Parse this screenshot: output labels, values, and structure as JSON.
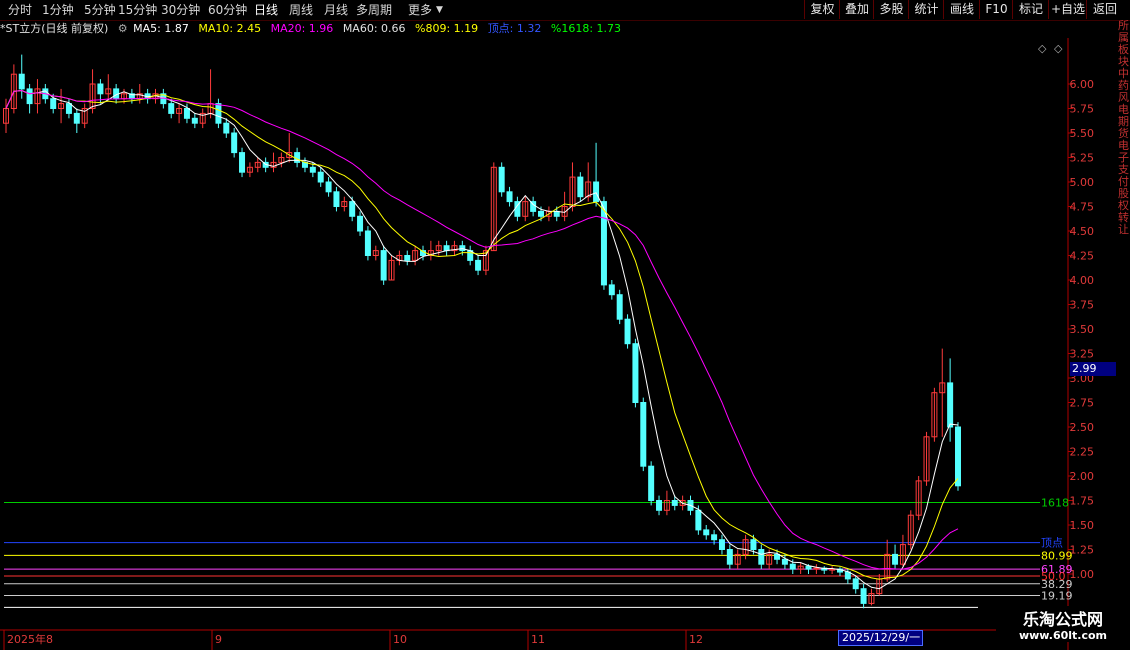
{
  "toolbar": {
    "periods": [
      "分时",
      "1分钟",
      "5分钟",
      "15分钟",
      "30分钟",
      "60分钟",
      "日线",
      "周线",
      "月线",
      "多周期",
      "更多"
    ],
    "active": "日线",
    "right_buttons": [
      "复权",
      "叠加",
      "多股",
      "统计",
      "画线",
      "F10",
      "标记",
      "+自选",
      "返回"
    ]
  },
  "info": {
    "title": "*ST立方(日线 前复权)",
    "ma5": "MA5: 1.87",
    "ma10": "MA10: 2.45",
    "ma20": "MA20: 1.96",
    "ma60": "MA60: 0.66",
    "p809": "%809: 1.19",
    "dingdian": "顶点: 1.32",
    "p1618": "%1618: 1.73",
    "colors": {
      "ma5": "#ffffff",
      "ma10": "#ffff00",
      "ma20": "#ff00ff",
      "ma60": "#00ff00",
      "p809": "#ffff00",
      "dingdian": "#3355ff",
      "p1618": "#00ff00"
    }
  },
  "y_axis": [
    "6.00",
    "5.75",
    "5.50",
    "5.25",
    "5.00",
    "4.75",
    "4.50",
    "4.25",
    "4.00",
    "3.75",
    "3.50",
    "3.25",
    "3.00",
    "2.75",
    "2.50",
    "2.25",
    "2.00",
    "1.75",
    "1.50",
    "1.25",
    "1.00"
  ],
  "fib_lines": [
    {
      "label": "1618",
      "value": 1.73,
      "color": "#00cc00"
    },
    {
      "label": "顶点",
      "value": 1.32,
      "color": "#2244ff"
    },
    {
      "label": "80.99",
      "value": 1.19,
      "color": "#ffff00"
    },
    {
      "label": "61.89",
      "value": 1.05,
      "color": "#ff44ff"
    },
    {
      "label": "50.0",
      "value": 0.98,
      "color": "#ff3333"
    },
    {
      "label": "38.29",
      "value": 0.9,
      "color": "#cccccc"
    },
    {
      "label": "19.19",
      "value": 0.78,
      "color": "#cccccc"
    },
    {
      "label": "",
      "value": 0.66,
      "color": "#ffffff"
    }
  ],
  "x_axis": [
    "2025年8",
    "9",
    "10",
    "11",
    "12"
  ],
  "current_price": "2.99",
  "date_label": "2025/12/29/一",
  "watermark": {
    "name": "乐淘公式网",
    "url": "www.60lt.com"
  },
  "right_strip": "所属板块中药风电期货电子支付股权转让",
  "chart_data": {
    "type": "candlestick",
    "y_range": [
      0.55,
      6.6
    ],
    "ma_colors": {
      "ma5": "#ffffff",
      "ma10": "#ffff00",
      "ma20": "#ff00ff"
    },
    "candles": [
      [
        5.6,
        5.75,
        5.5,
        5.85
      ],
      [
        5.75,
        6.1,
        5.7,
        6.2
      ],
      [
        6.1,
        5.95,
        5.85,
        6.3
      ],
      [
        5.95,
        5.8,
        5.7,
        6.0
      ],
      [
        5.8,
        5.95,
        5.7,
        6.05
      ],
      [
        5.95,
        5.85,
        5.8,
        6.0
      ],
      [
        5.85,
        5.75,
        5.7,
        5.9
      ],
      [
        5.75,
        5.8,
        5.6,
        5.95
      ],
      [
        5.8,
        5.7,
        5.65,
        5.85
      ],
      [
        5.7,
        5.6,
        5.5,
        5.75
      ],
      [
        5.6,
        5.75,
        5.55,
        5.8
      ],
      [
        5.75,
        6.0,
        5.7,
        6.15
      ],
      [
        6.0,
        5.9,
        5.8,
        6.05
      ],
      [
        5.9,
        5.95,
        5.85,
        6.1
      ],
      [
        5.95,
        5.85,
        5.8,
        6.0
      ],
      [
        5.85,
        5.9,
        5.8,
        5.95
      ],
      [
        5.9,
        5.85,
        5.8,
        5.95
      ],
      [
        5.85,
        5.9,
        5.8,
        6.0
      ],
      [
        5.9,
        5.85,
        5.8,
        5.95
      ],
      [
        5.85,
        5.9,
        5.8,
        5.95
      ],
      [
        5.9,
        5.8,
        5.75,
        5.95
      ],
      [
        5.8,
        5.7,
        5.65,
        5.85
      ],
      [
        5.7,
        5.75,
        5.6,
        5.8
      ],
      [
        5.75,
        5.65,
        5.6,
        5.8
      ],
      [
        5.65,
        5.6,
        5.55,
        5.7
      ],
      [
        5.6,
        5.7,
        5.55,
        5.75
      ],
      [
        5.7,
        5.8,
        5.65,
        6.15
      ],
      [
        5.8,
        5.6,
        5.55,
        5.85
      ],
      [
        5.6,
        5.5,
        5.45,
        5.65
      ],
      [
        5.5,
        5.3,
        5.25,
        5.55
      ],
      [
        5.3,
        5.1,
        5.05,
        5.35
      ],
      [
        5.1,
        5.15,
        5.05,
        5.2
      ],
      [
        5.15,
        5.2,
        5.1,
        5.25
      ],
      [
        5.2,
        5.15,
        5.1,
        5.25
      ],
      [
        5.15,
        5.2,
        5.1,
        5.3
      ],
      [
        5.2,
        5.25,
        5.15,
        5.3
      ],
      [
        5.25,
        5.3,
        5.2,
        5.5
      ],
      [
        5.3,
        5.2,
        5.15,
        5.35
      ],
      [
        5.2,
        5.15,
        5.1,
        5.25
      ],
      [
        5.15,
        5.1,
        5.05,
        5.2
      ],
      [
        5.1,
        5.0,
        4.95,
        5.15
      ],
      [
        5.0,
        4.9,
        4.85,
        5.05
      ],
      [
        4.9,
        4.75,
        4.7,
        4.95
      ],
      [
        4.75,
        4.8,
        4.7,
        4.85
      ],
      [
        4.8,
        4.65,
        4.6,
        4.85
      ],
      [
        4.65,
        4.5,
        4.45,
        4.7
      ],
      [
        4.5,
        4.25,
        4.2,
        4.55
      ],
      [
        4.25,
        4.3,
        4.2,
        4.35
      ],
      [
        4.3,
        4.0,
        3.95,
        4.35
      ],
      [
        4.0,
        4.2,
        4.0,
        4.25
      ],
      [
        4.2,
        4.25,
        4.15,
        4.3
      ],
      [
        4.25,
        4.2,
        4.15,
        4.3
      ],
      [
        4.2,
        4.3,
        4.15,
        4.35
      ],
      [
        4.3,
        4.25,
        4.2,
        4.35
      ],
      [
        4.25,
        4.3,
        4.2,
        4.4
      ],
      [
        4.3,
        4.35,
        4.25,
        4.4
      ],
      [
        4.35,
        4.3,
        4.25,
        4.4
      ],
      [
        4.3,
        4.35,
        4.25,
        4.4
      ],
      [
        4.35,
        4.3,
        4.25,
        4.4
      ],
      [
        4.3,
        4.2,
        4.15,
        4.35
      ],
      [
        4.2,
        4.1,
        4.05,
        4.25
      ],
      [
        4.1,
        4.3,
        4.05,
        4.35
      ],
      [
        4.3,
        5.15,
        4.3,
        5.2
      ],
      [
        5.15,
        4.9,
        4.85,
        5.2
      ],
      [
        4.9,
        4.8,
        4.75,
        4.95
      ],
      [
        4.8,
        4.65,
        4.6,
        4.85
      ],
      [
        4.65,
        4.8,
        4.6,
        4.85
      ],
      [
        4.8,
        4.7,
        4.65,
        4.85
      ],
      [
        4.7,
        4.65,
        4.6,
        4.75
      ],
      [
        4.65,
        4.7,
        4.6,
        4.75
      ],
      [
        4.7,
        4.65,
        4.6,
        4.75
      ],
      [
        4.65,
        4.75,
        4.6,
        4.9
      ],
      [
        4.75,
        5.05,
        4.7,
        5.2
      ],
      [
        5.05,
        4.85,
        4.8,
        5.1
      ],
      [
        4.85,
        5.0,
        4.8,
        5.2
      ],
      [
        5.0,
        4.8,
        4.75,
        5.4
      ],
      [
        4.8,
        3.95,
        3.9,
        4.85
      ],
      [
        3.95,
        3.85,
        3.8,
        4.0
      ],
      [
        3.85,
        3.6,
        3.55,
        3.9
      ],
      [
        3.6,
        3.35,
        3.3,
        3.65
      ],
      [
        3.35,
        2.75,
        2.7,
        3.4
      ],
      [
        2.75,
        2.1,
        2.05,
        2.8
      ],
      [
        2.1,
        1.75,
        1.7,
        2.15
      ],
      [
        1.75,
        1.65,
        1.6,
        1.8
      ],
      [
        1.65,
        1.75,
        1.6,
        1.85
      ],
      [
        1.75,
        1.7,
        1.65,
        1.8
      ],
      [
        1.7,
        1.75,
        1.65,
        1.8
      ],
      [
        1.75,
        1.65,
        1.6,
        1.8
      ],
      [
        1.65,
        1.45,
        1.4,
        1.7
      ],
      [
        1.45,
        1.4,
        1.35,
        1.5
      ],
      [
        1.4,
        1.35,
        1.3,
        1.45
      ],
      [
        1.35,
        1.25,
        1.2,
        1.4
      ],
      [
        1.25,
        1.1,
        1.05,
        1.3
      ],
      [
        1.1,
        1.2,
        1.05,
        1.25
      ],
      [
        1.2,
        1.35,
        1.15,
        1.4
      ],
      [
        1.35,
        1.25,
        1.2,
        1.4
      ],
      [
        1.25,
        1.1,
        1.05,
        1.3
      ],
      [
        1.1,
        1.2,
        1.05,
        1.25
      ],
      [
        1.2,
        1.15,
        1.1,
        1.25
      ],
      [
        1.15,
        1.1,
        1.05,
        1.2
      ],
      [
        1.1,
        1.05,
        1.0,
        1.15
      ],
      [
        1.05,
        1.08,
        1.0,
        1.12
      ],
      [
        1.08,
        1.05,
        1.0,
        1.1
      ],
      [
        1.05,
        1.06,
        1.0,
        1.1
      ],
      [
        1.06,
        1.04,
        1.0,
        1.08
      ],
      [
        1.04,
        1.05,
        1.0,
        1.08
      ],
      [
        1.05,
        1.02,
        0.98,
        1.07
      ],
      [
        1.02,
        0.95,
        0.9,
        1.05
      ],
      [
        0.95,
        0.85,
        0.8,
        0.98
      ],
      [
        0.85,
        0.7,
        0.65,
        0.9
      ],
      [
        0.7,
        0.8,
        0.68,
        0.85
      ],
      [
        0.8,
        0.95,
        0.78,
        1.0
      ],
      [
        0.95,
        1.2,
        0.92,
        1.35
      ],
      [
        1.2,
        1.1,
        1.05,
        1.3
      ],
      [
        1.1,
        1.3,
        1.08,
        1.4
      ],
      [
        1.3,
        1.6,
        1.25,
        1.65
      ],
      [
        1.6,
        1.95,
        1.55,
        2.0
      ],
      [
        1.95,
        2.4,
        1.9,
        2.45
      ],
      [
        2.4,
        2.85,
        2.35,
        2.9
      ],
      [
        2.85,
        2.95,
        2.4,
        3.3
      ],
      [
        2.95,
        2.5,
        2.35,
        3.2
      ],
      [
        2.5,
        1.9,
        1.85,
        2.55
      ]
    ]
  }
}
